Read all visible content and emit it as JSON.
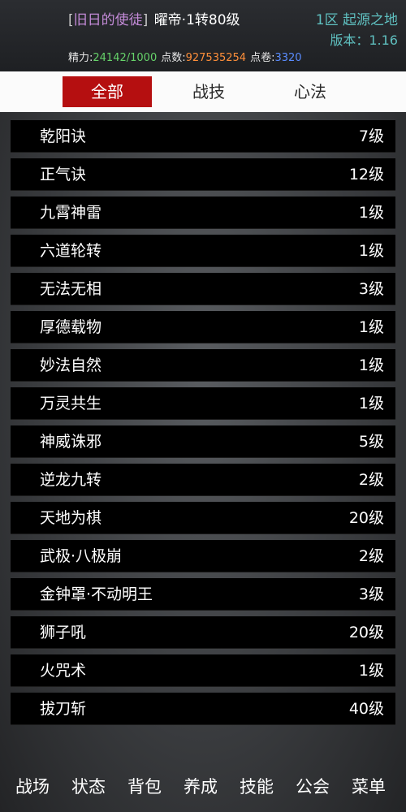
{
  "header": {
    "title_open": "[",
    "title": "旧日的使徒",
    "title_close": "]",
    "realm": "曜帝·1转80级",
    "server": "1区 起源之地",
    "version": "版本：1.16",
    "stats": {
      "energy_label": "精力:",
      "energy_value": "24142/1000",
      "points_label": "点数:",
      "points_value": "927535254",
      "scroll_label": "点卷:",
      "scroll_value": "3320"
    }
  },
  "tabs": [
    {
      "label": "全部",
      "active": true
    },
    {
      "label": "战技",
      "active": false
    },
    {
      "label": "心法",
      "active": false
    }
  ],
  "skills": [
    {
      "name": "乾阳诀",
      "level": "7级"
    },
    {
      "name": "正气诀",
      "level": "12级"
    },
    {
      "name": "九霄神雷",
      "level": "1级"
    },
    {
      "name": "六道轮转",
      "level": "1级"
    },
    {
      "name": "无法无相",
      "level": "3级"
    },
    {
      "name": "厚德载物",
      "level": "1级"
    },
    {
      "name": "妙法自然",
      "level": "1级"
    },
    {
      "name": "万灵共生",
      "level": "1级"
    },
    {
      "name": "神威诛邪",
      "level": "5级"
    },
    {
      "name": "逆龙九转",
      "level": "2级"
    },
    {
      "name": "天地为棋",
      "level": "20级"
    },
    {
      "name": "武极·八极崩",
      "level": "2级"
    },
    {
      "name": "金钟罩·不动明王",
      "level": "3级"
    },
    {
      "name": "狮子吼",
      "level": "20级"
    },
    {
      "name": "火咒术",
      "level": "1级"
    },
    {
      "name": "拔刀斩",
      "level": "40级"
    }
  ],
  "nav": [
    "战场",
    "状态",
    "背包",
    "养成",
    "技能",
    "公会",
    "菜单"
  ],
  "colors": {
    "accent_red": "#b50f10",
    "title_purple": "#c48bd8",
    "server_teal": "#5fc0c0",
    "energy_green": "#66d36a",
    "points_orange": "#ff8f3a",
    "scroll_blue": "#5a8cff"
  }
}
